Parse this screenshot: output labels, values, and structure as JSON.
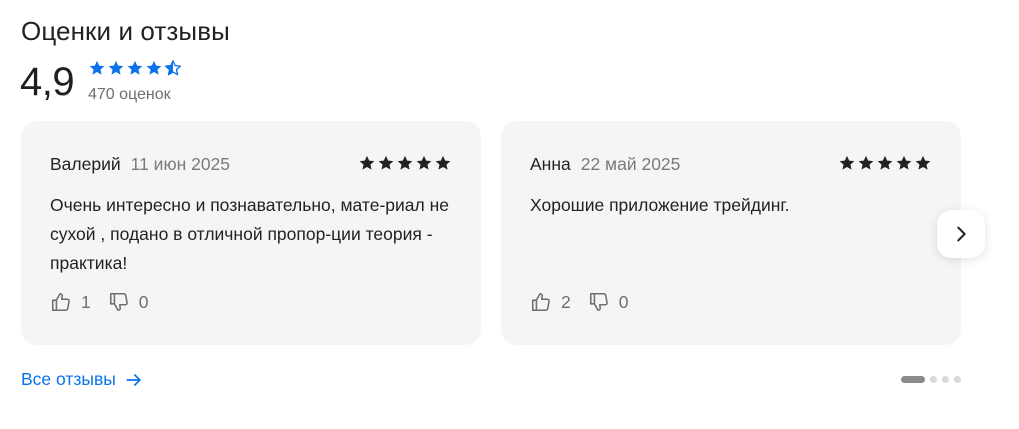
{
  "section": {
    "title": "Оценки и отзывы",
    "rating": "4,9",
    "rating_stars": 4.5,
    "rating_count": "470 оценок",
    "accent_color": "#0a73eb"
  },
  "reviews": [
    {
      "author": "Валерий",
      "date": "11 июн 2025",
      "stars": 5,
      "text": "Очень интересно и познавательно, мате-риал не сухой , подано в отличной пропор-ции теория - практика!",
      "likes": "1",
      "dislikes": "0"
    },
    {
      "author": "Анна",
      "date": "22 май 2025",
      "stars": 5,
      "text": "Хорошие приложение трейдинг.",
      "likes": "2",
      "dislikes": "0"
    }
  ],
  "icons": {
    "star": "star-icon",
    "half_star": "half-star-icon",
    "like": "thumbs-up-icon",
    "dislike": "thumbs-down-icon",
    "next": "chevron-right-icon",
    "arrow": "arrow-right-icon"
  },
  "footer": {
    "all_reviews_label": "Все отзывы"
  },
  "pagination": {
    "pages": 4,
    "active_index": 0
  }
}
